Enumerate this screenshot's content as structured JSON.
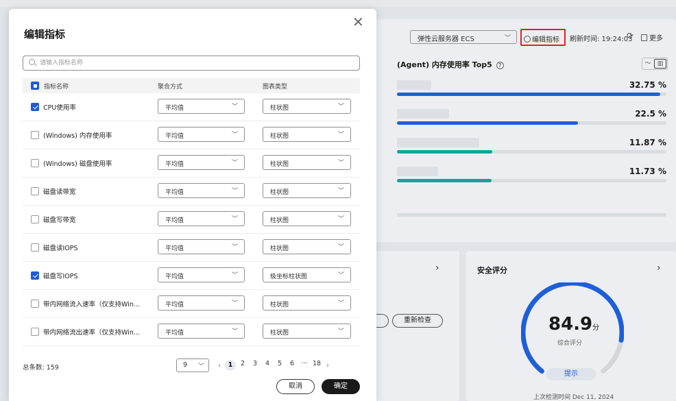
{
  "background": {
    "server_select": "弹性云服务器 ECS",
    "edit_metrics_label": "编辑指标",
    "refresh_time_label": "刷新时间: 19:24:03",
    "more_label": "更多",
    "chart": {
      "title": "(Agent) 内存使用率 Top5",
      "bars": [
        {
          "value_label": "32.75 %",
          "percent": 32.75,
          "color": "#1e5fd8"
        },
        {
          "value_label": "22.5 %",
          "percent": 22.5,
          "color": "#1e5fd8"
        },
        {
          "value_label": "11.87 %",
          "percent": 11.87,
          "color": "#17a398"
        },
        {
          "value_label": "11.73 %",
          "percent": 11.73,
          "color": "#17a398"
        }
      ]
    },
    "security": {
      "title": "安全评分",
      "score": "84.9",
      "score_unit": "分",
      "score_label": "综合评分",
      "tip_label": "提示",
      "last_check": "上次检测时间 Dec 11, 2024",
      "gauge_color": "#1e5fd8"
    },
    "recheck_label": "重新检查"
  },
  "modal": {
    "title": "编辑指标",
    "search_placeholder": "请输入指标名称",
    "columns": {
      "name": "指标名称",
      "aggregation": "聚合方式",
      "chart_type": "图表类型"
    },
    "rows": [
      {
        "name": "CPU使用率",
        "checked": true,
        "aggregation": "平均值",
        "chart_type": "柱状图"
      },
      {
        "name": "(Windows) 内存使用率",
        "checked": false,
        "aggregation": "平均值",
        "chart_type": "柱状图"
      },
      {
        "name": "(Windows) 磁盘使用率",
        "checked": false,
        "aggregation": "平均值",
        "chart_type": "柱状图"
      },
      {
        "name": "磁盘读带宽",
        "checked": false,
        "aggregation": "平均值",
        "chart_type": "柱状图"
      },
      {
        "name": "磁盘写带宽",
        "checked": false,
        "aggregation": "平均值",
        "chart_type": "柱状图"
      },
      {
        "name": "磁盘读IOPS",
        "checked": false,
        "aggregation": "平均值",
        "chart_type": "柱状图"
      },
      {
        "name": "磁盘写IOPS",
        "checked": true,
        "aggregation": "平均值",
        "chart_type": "极坐标柱状图"
      },
      {
        "name": "带内网络流入速率（仅支持Win...",
        "checked": false,
        "aggregation": "平均值",
        "chart_type": "柱状图"
      },
      {
        "name": "带内网络流出速率（仅支持Win...",
        "checked": false,
        "aggregation": "平均值",
        "chart_type": "柱状图"
      }
    ],
    "total_label": "总条数: 159",
    "page_size": "9",
    "pages": [
      "1",
      "2",
      "3",
      "4",
      "5",
      "6",
      "···",
      "18"
    ],
    "current_page": "1",
    "cancel_label": "取消",
    "ok_label": "确定",
    "accent_color": "#1f5bd6"
  }
}
